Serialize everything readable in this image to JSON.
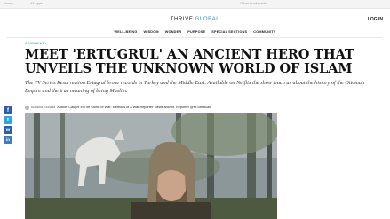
{
  "browser": {
    "home_label": "Home",
    "tab_label": "All apps",
    "extra_label": "Other bookmarks"
  },
  "site": {
    "logo_main": "THRIVE",
    "logo_accent": "GLOBAL",
    "login": "LOG IN",
    "accent_color": "#2f8fb0"
  },
  "nav": {
    "items": [
      "WELL-BEING",
      "WISDOM",
      "WONDER",
      "PURPOSE",
      "SPECIAL SECTIONS",
      "COMMUNITY"
    ]
  },
  "article": {
    "category": "COMMUNITY",
    "headline": "MEET 'ERTUGRUL' AN ANCIENT HERO THAT UNVEILS THE UNKNOWN WORLD OF ISLAM",
    "dek": "The TV Series Resurrection Ertugrul broke records in Turkey and the Middle East. Available on Netflix the show teach us about the history of the Ottoman Empire and the true meaning of being Muslim.",
    "author_name": "Adriana Estrada",
    "author_bio": "Author 'Caught In The Storm of War: Memoirs of a War Reporter' News anchor. Reporter @MTMexicali"
  },
  "share": {
    "facebook": "f",
    "twitter": "t",
    "whatsapp": "w",
    "linkedin": "in"
  }
}
